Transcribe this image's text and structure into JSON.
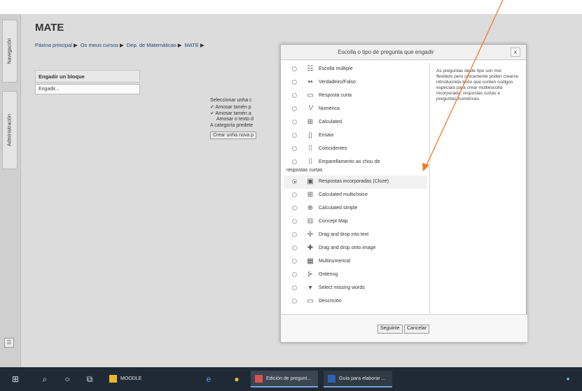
{
  "course": {
    "title": "MATE"
  },
  "breadcrumb": [
    "Páxina principal",
    "Os meus cursos",
    "Dep. de Matemáticas",
    "MATE"
  ],
  "side_tabs": {
    "navigation": "Navegación",
    "admin": "Administración"
  },
  "block": {
    "header": "Engadir un bloque",
    "select_value": "Engadir..."
  },
  "bg_form": {
    "select_label": "Seleccionar unha c",
    "checks": [
      "Amosar tamén p",
      "Amosar tamén a",
      "Amosar o texto d"
    ],
    "default_category": "A categoría predete",
    "create_button": "Crear unha nova p"
  },
  "dialog": {
    "title": "Escolla o tipo de pregunta que engadir",
    "close": "x",
    "description": "As preguntas deste tipo son moi flexibels pero unicamente poden crearse introducindo texto que conten codigos especiais para crear multiescolla incorporada, respostas curtas e preguntas numéricas.",
    "question_types": [
      {
        "label": "Escolla múltiple",
        "icon": "multichoice-icon",
        "glyph": "☷"
      },
      {
        "label": "Verdadeiro/Falso",
        "icon": "truefalse-icon",
        "glyph": "••"
      },
      {
        "label": "Resposta curta",
        "icon": "shortanswer-icon",
        "glyph": "▭"
      },
      {
        "label": "Numérica",
        "icon": "numerical-icon",
        "glyph": "⅟"
      },
      {
        "label": "Calculated",
        "icon": "calculated-icon",
        "glyph": "⊞"
      },
      {
        "label": "Ensaio",
        "icon": "essay-icon",
        "glyph": "▯"
      },
      {
        "label": "Coincidentes",
        "icon": "match-icon",
        "glyph": "⁞⁞"
      },
      {
        "label": "Emparellamento ao chou de",
        "label2": "respostas curtas",
        "icon": "randomsamatch-icon",
        "glyph": "⁞⁞"
      },
      {
        "label": "Respostas incorporadas (Cloze)",
        "icon": "cloze-icon",
        "glyph": "▣",
        "selected": true
      },
      {
        "label": "Calculated multichoice",
        "icon": "calculatedmulti-icon",
        "glyph": "⊞"
      },
      {
        "label": "Calculated simple",
        "icon": "calculatedsimple-icon",
        "glyph": "⊕"
      },
      {
        "label": "Concept Map",
        "icon": "conceptmap-icon",
        "glyph": "⊟"
      },
      {
        "label": "Drag and drop into text",
        "icon": "ddwtos-icon",
        "glyph": "✢"
      },
      {
        "label": "Drag and drop onto image",
        "icon": "ddimage-icon",
        "glyph": "✚"
      },
      {
        "label": "Multinumerical",
        "icon": "multinumerical-icon",
        "glyph": "▦"
      },
      {
        "label": "Ordering",
        "icon": "ordering-icon",
        "glyph": "⊱"
      },
      {
        "label": "Select missing words",
        "icon": "gapselect-icon",
        "glyph": "▾"
      },
      {
        "label": "Descrición",
        "icon": "description-icon",
        "glyph": "▭"
      }
    ],
    "next_button": "Seguinte",
    "cancel_button": "Cancelar"
  },
  "taskbar": {
    "apps": [
      {
        "label": "MOODLE"
      },
      {
        "label": "Edición de pregunt..."
      },
      {
        "label": "Guía para elaborar ..."
      }
    ]
  },
  "colors": {
    "arrow": "#f07a2a",
    "taskbar": "#1f2a36",
    "link": "#22447a"
  }
}
